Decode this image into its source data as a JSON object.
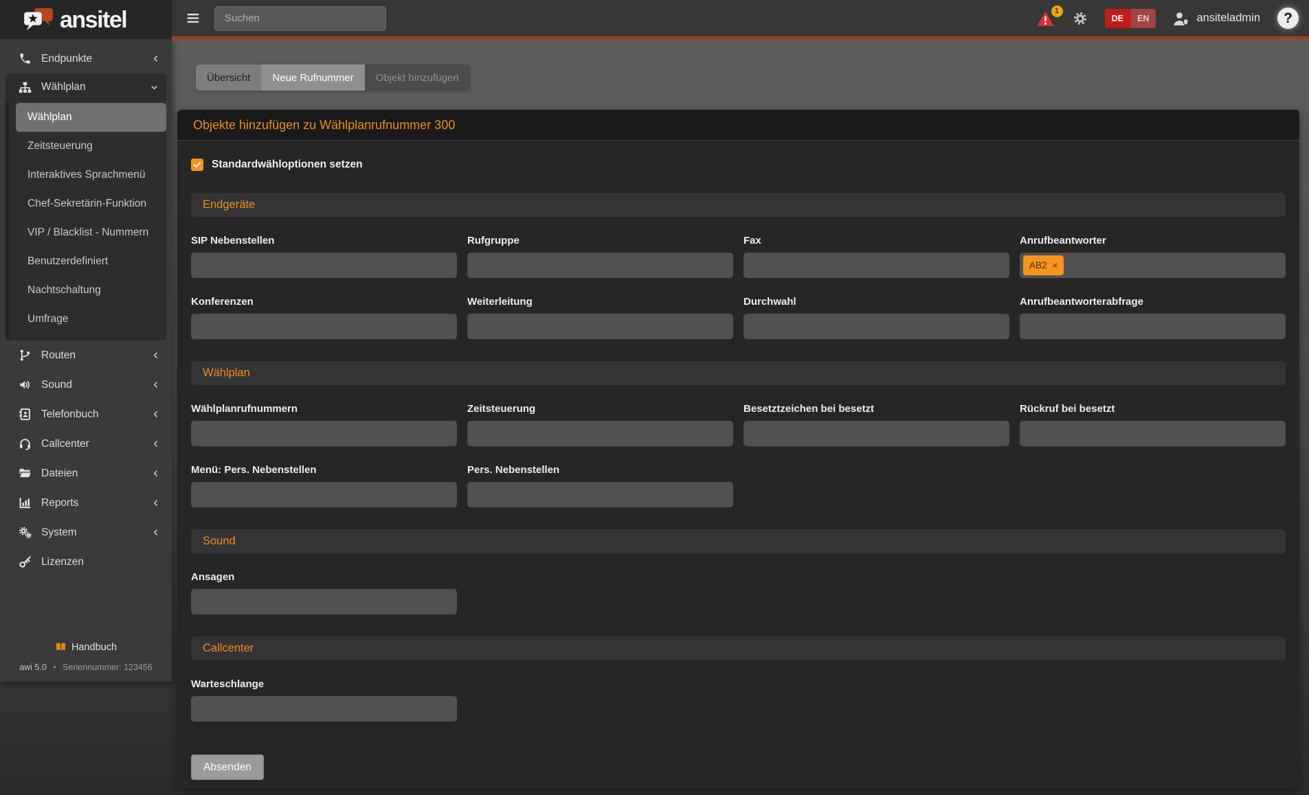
{
  "brand": {
    "name": "ansitel"
  },
  "topbar": {
    "search_placeholder": "Suchen",
    "alert_badge": "1",
    "lang": {
      "de": "DE",
      "en": "EN"
    },
    "user": {
      "name": "ansiteladmin"
    },
    "help_label": "?"
  },
  "sidebar": {
    "items": [
      {
        "label": "Endpunkte",
        "icon": "phone-icon"
      },
      {
        "label": "Wählplan",
        "icon": "sitemap-icon",
        "expanded": true
      },
      {
        "label": "Routen",
        "icon": "route-icon"
      },
      {
        "label": "Sound",
        "icon": "volume-icon"
      },
      {
        "label": "Telefonbuch",
        "icon": "address-book-icon"
      },
      {
        "label": "Callcenter",
        "icon": "headset-icon"
      },
      {
        "label": "Dateien",
        "icon": "folder-open-icon"
      },
      {
        "label": "Reports",
        "icon": "chart-bar-icon"
      },
      {
        "label": "System",
        "icon": "gears-icon"
      },
      {
        "label": "Lizenzen",
        "icon": "key-icon"
      }
    ],
    "submenu": {
      "active_index": 0,
      "items": [
        "Wählplan",
        "Zeitsteuerung",
        "Interaktives Sprachmenü",
        "Chef-Sekretärin-Funktion",
        "VIP / Blacklist - Nummern",
        "Benutzerdefiniert",
        "Nachtschaltung",
        "Umfrage"
      ]
    },
    "footer": {
      "manual": "Handbuch",
      "version": "awi 5.0",
      "separator": "•",
      "serial": "Seriennummer: 123456"
    }
  },
  "tabs": [
    "Übersicht",
    "Neue Rufnummer",
    "Objekt hinzufügen"
  ],
  "panel": {
    "title": "Objekte hinzufügen zu Wählplanrufnummer 300",
    "checkbox": {
      "checked": true,
      "label": "Standardwähloptionen setzen"
    },
    "sections": {
      "endgeraete": {
        "title": "Endgeräte",
        "fields": [
          "SIP Nebenstellen",
          "Rufgruppe",
          "Fax",
          "Anrufbeantworter",
          "Konferenzen",
          "Weiterleitung",
          "Durchwahl",
          "Anrufbeantworterabfrage"
        ],
        "tag": {
          "label": "AB2",
          "remove": "×",
          "in_field": "Anrufbeantworter"
        }
      },
      "waehlplan": {
        "title": "Wählplan",
        "fields": [
          "Wählplanrufnummern",
          "Zeitsteuerung",
          "Besetztzeichen bei besetzt",
          "Rückruf bei besetzt",
          "Menü: Pers. Nebenstellen",
          "Pers. Nebenstellen"
        ]
      },
      "sound": {
        "title": "Sound",
        "fields": [
          "Ansagen"
        ]
      },
      "callcenter": {
        "title": "Callcenter",
        "fields": [
          "Warteschlange"
        ]
      }
    },
    "submit_label": "Absenden"
  },
  "colors": {
    "accent_orange": "#ef8b1d",
    "tag_orange": "#f7941d",
    "topbar_rule": "#ab3c14",
    "lang_de_bg": "#c41a1a",
    "lang_en_bg": "#a04444",
    "alert_red": "#d63333",
    "badge_yellow": "#e9a80c"
  }
}
